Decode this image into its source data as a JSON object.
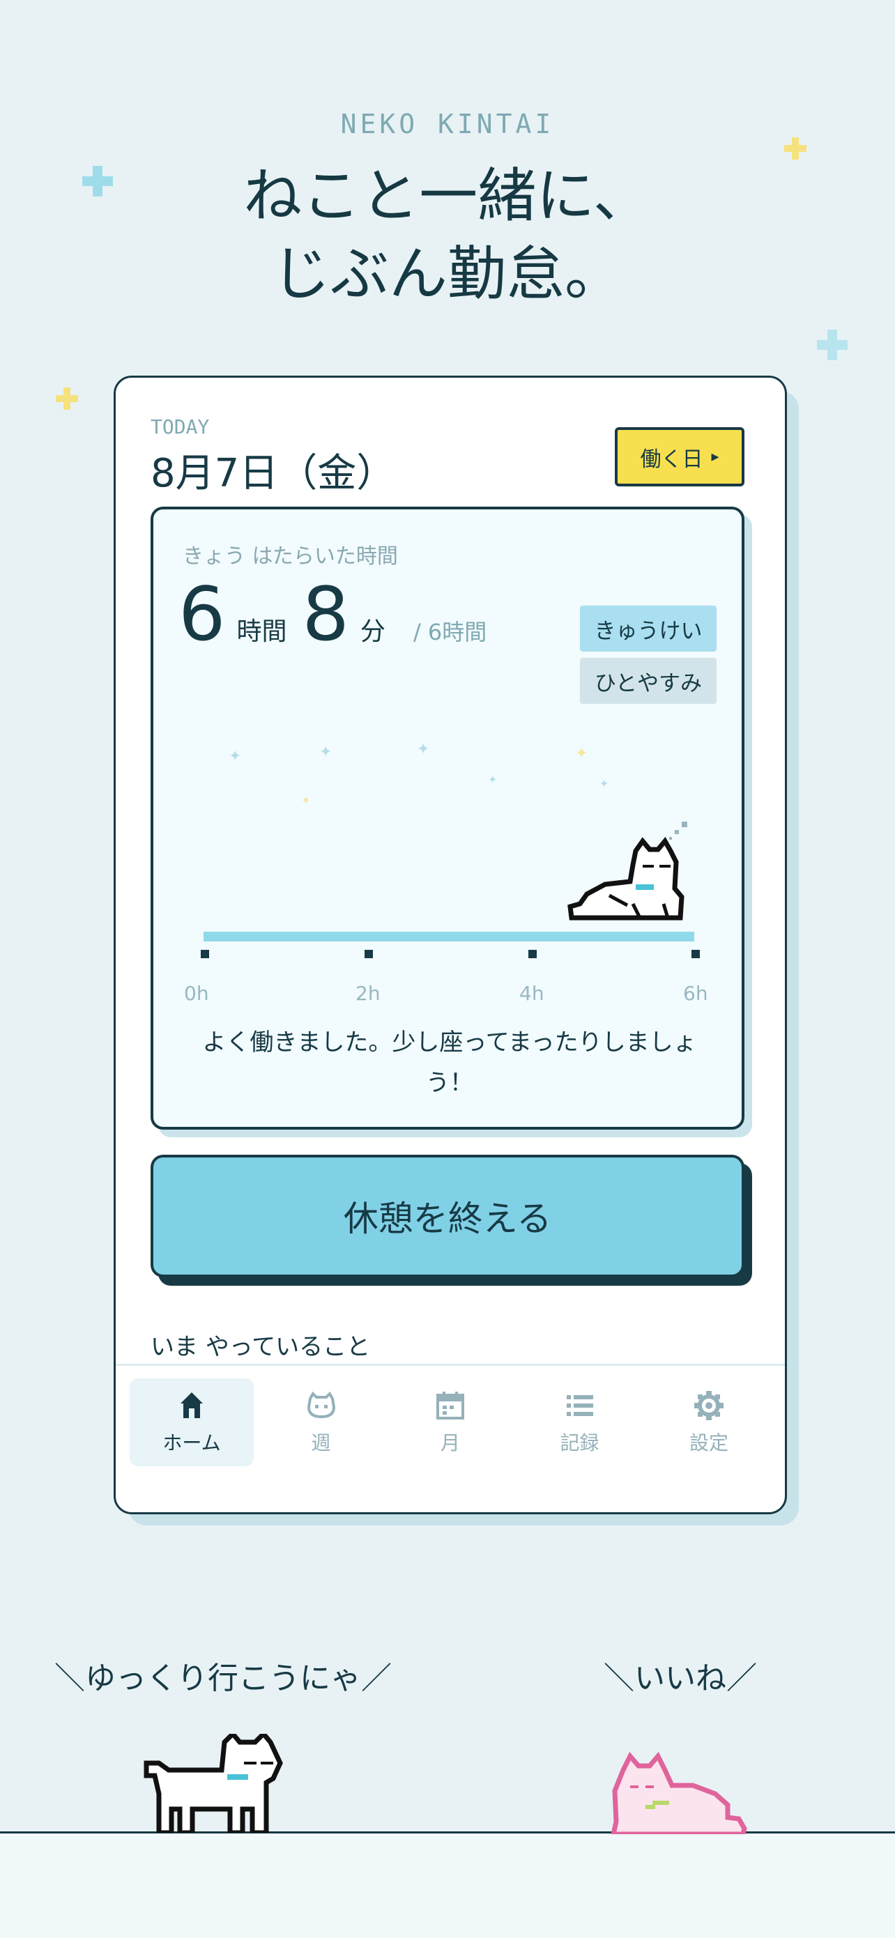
{
  "app": {
    "brand": "NEKO KINTAI",
    "headline_line1": "ねこと一緒に、",
    "headline_line2": "じぶん勤怠。"
  },
  "card": {
    "today_label": "TODAY",
    "date": "8月7日（金）",
    "work_day_button": "働く日",
    "work_day_arrow": "▸"
  },
  "summary": {
    "worked_label": "きょう はたらいた時間",
    "hours": "6",
    "hours_unit": "時間",
    "minutes": "8",
    "minutes_unit": "分",
    "target": "/ 6時間",
    "break_status": "きゅうけい",
    "rest_status": "ひとやすみ",
    "timeline_labels": [
      "0h",
      "2h",
      "4h",
      "6h"
    ],
    "message": "よく働きました。少し座ってまったりしましょう！"
  },
  "actions": {
    "end_break": "休憩を終える",
    "doing_label": "いま やっていること"
  },
  "nav": {
    "items": [
      {
        "label": "ホーム",
        "icon": "home-icon"
      },
      {
        "label": "週",
        "icon": "cat-face-icon"
      },
      {
        "label": "月",
        "icon": "calendar-icon"
      },
      {
        "label": "記録",
        "icon": "list-icon"
      },
      {
        "label": "設定",
        "icon": "gear-icon"
      }
    ]
  },
  "cats": {
    "left_speech": "＼ゆっくり行こうにゃ／",
    "right_speech": "＼いいね／"
  },
  "colors": {
    "background": "#e8f2f5",
    "accent_blue": "#80d1e6",
    "accent_yellow": "#f8df4f",
    "ink": "#173a45"
  }
}
